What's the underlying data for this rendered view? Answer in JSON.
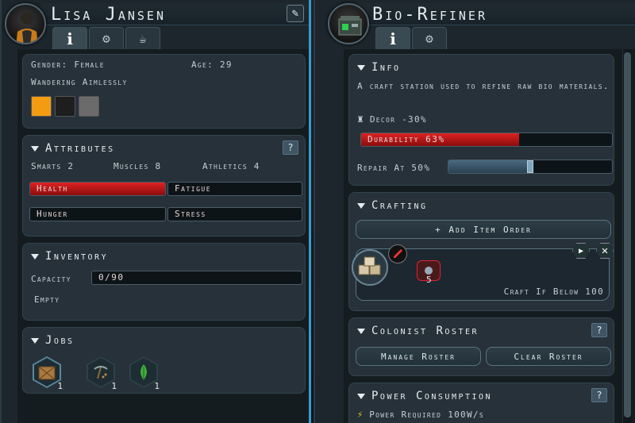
{
  "colonist": {
    "name": "Lisa Jansen",
    "tabs": [
      "i",
      "gear",
      "hand"
    ],
    "gender_label": "Gender: Female",
    "age_label": "Age: 29",
    "status": "Wandering Aimlessly",
    "swatches": [
      "#f39c12",
      "#1e1e1e",
      "#6b6b6b"
    ],
    "attributes": {
      "title": "Attributes",
      "help": "?",
      "smarts": "Smarts 2",
      "muscles": "Muscles 8",
      "athletics": "Athletics 4",
      "needs": [
        {
          "label": "Health",
          "fill": 1.0,
          "color": "#c0201f"
        },
        {
          "label": "Fatigue",
          "fill": 0
        },
        {
          "label": "Hunger",
          "fill": 0
        },
        {
          "label": "Stress",
          "fill": 0
        }
      ]
    },
    "inventory": {
      "title": "Inventory",
      "capacity_label": "Capacity",
      "capacity_value": "0/90",
      "empty": "Empty"
    },
    "jobs": {
      "title": "Jobs",
      "items": [
        {
          "icon": "crate-icon",
          "count": "1"
        },
        {
          "icon": "pickaxe-icon",
          "count": "1"
        },
        {
          "icon": "leaf-icon",
          "count": "1"
        }
      ]
    }
  },
  "building": {
    "name": "Bio-Refiner",
    "info": {
      "title": "Info",
      "description": "A craft station used to refine raw bio materials.",
      "decor": "Decor -30%",
      "durability_label": "Durability 63%",
      "durability": 0.63,
      "repair_label": "Repair At 50%",
      "repair": 0.5
    },
    "crafting": {
      "title": "Crafting",
      "add_order": "+ Add Item Order",
      "order_count": "5",
      "craft_if_below": "Craft If Below 100"
    },
    "roster": {
      "title": "Colonist Roster",
      "help": "?",
      "manage": "Manage Roster",
      "clear": "Clear Roster"
    },
    "power": {
      "title": "Power Consumption",
      "help": "?",
      "required": "Power Required 100W/s"
    }
  }
}
